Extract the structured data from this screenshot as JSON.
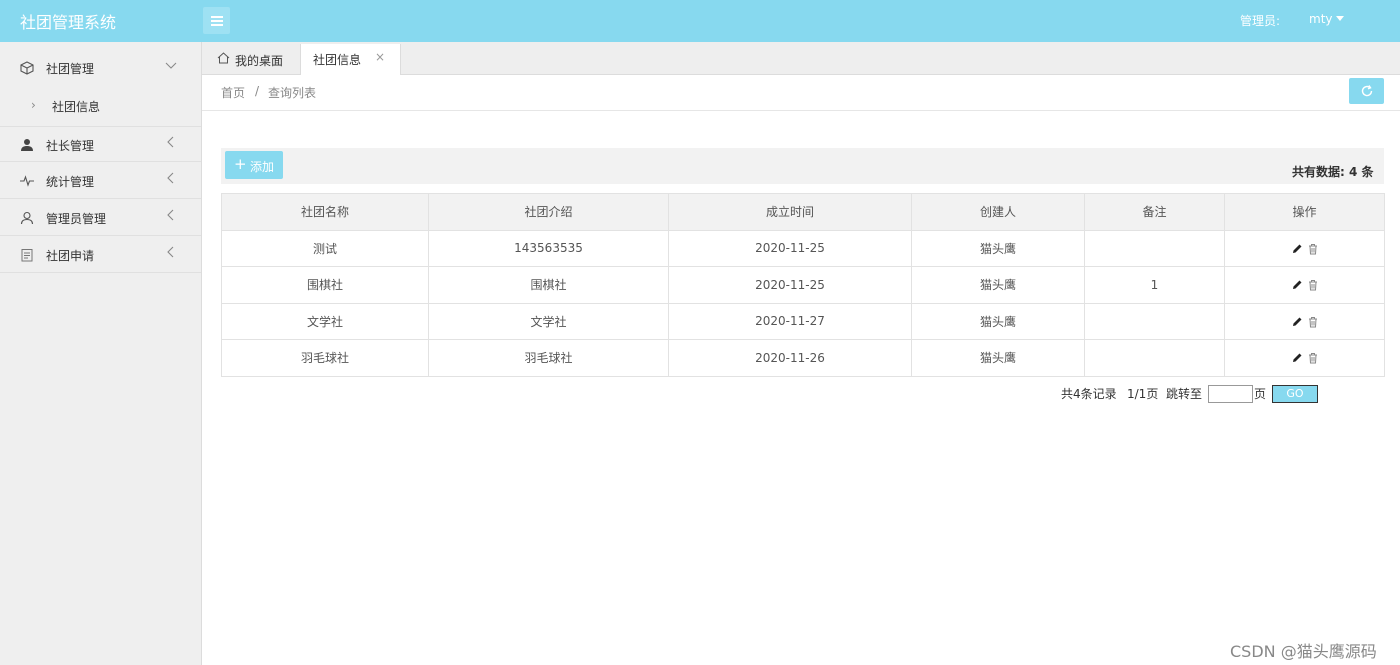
{
  "header": {
    "app_title": "社团管理系统",
    "admin_label": "管理员:",
    "admin_user": "mty",
    "colors": {
      "brand": "#87d9ef",
      "sidebar_bg": "#efefef"
    }
  },
  "sidebar": {
    "items": [
      {
        "label": "社团管理",
        "icon": "box-icon",
        "expanded": true,
        "children": [
          {
            "label": "社团信息"
          }
        ]
      },
      {
        "label": "社长管理",
        "icon": "person-icon"
      },
      {
        "label": "统计管理",
        "icon": "pulse-icon"
      },
      {
        "label": "管理员管理",
        "icon": "user-outline-icon"
      },
      {
        "label": "社团申请",
        "icon": "clipboard-icon"
      }
    ]
  },
  "tabs": [
    {
      "label": "我的桌面",
      "icon": "home-icon"
    },
    {
      "label": "社团信息",
      "active": true,
      "close": "×"
    }
  ],
  "breadcrumb": {
    "home": "首页",
    "separator": "/",
    "current": "查询列表"
  },
  "toolbar": {
    "add_label": "添加",
    "total_label": "共有数据: 4 条"
  },
  "table": {
    "columns": [
      "社团名称",
      "社团介绍",
      "成立时间",
      "创建人",
      "备注",
      "操作"
    ],
    "rows": [
      [
        "测试",
        "143563535",
        "2020-11-25",
        "猫头鹰",
        ""
      ],
      [
        "围棋社",
        "围棋社",
        "2020-11-25",
        "猫头鹰",
        "1"
      ],
      [
        "文学社",
        "文学社",
        "2020-11-27",
        "猫头鹰",
        ""
      ],
      [
        "羽毛球社",
        "羽毛球社",
        "2020-11-26",
        "猫头鹰",
        ""
      ]
    ]
  },
  "pagination": {
    "records_text": "共4条记录",
    "page_text": "1/1页",
    "jump_label": "跳转至",
    "page_suffix": "页",
    "go_label": "GO"
  },
  "watermark": "CSDN @猫头鹰源码"
}
